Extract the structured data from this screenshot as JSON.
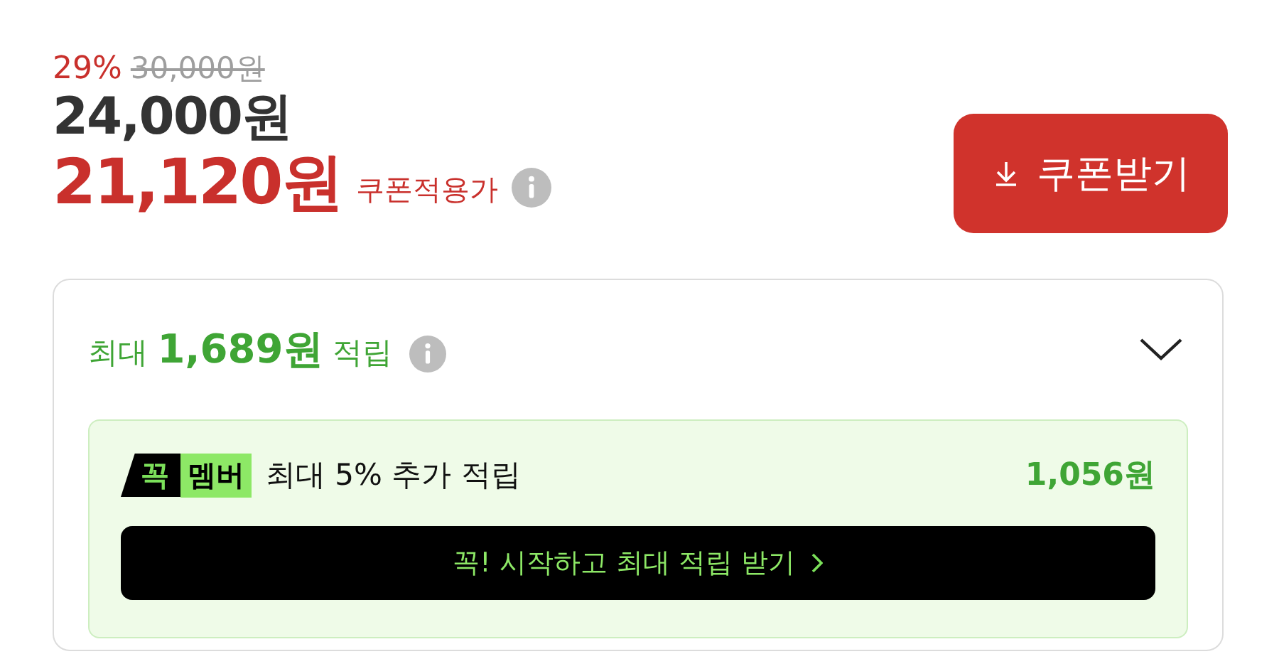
{
  "price": {
    "discount_rate": "29%",
    "original_price": "30,000원",
    "sale_price": "24,000원",
    "coupon_price": "21,120원",
    "coupon_label": "쿠폰적용가"
  },
  "coupon_button": {
    "label": "쿠폰받기"
  },
  "reward": {
    "summary": "최대 **1,689원** 적립",
    "membership": {
      "badge_mark": "꼭",
      "badge_label": "멤버",
      "description": "최대 5% 추가 적립",
      "amount": "1,056원",
      "cta": "꼭! 시작하고 최대 적립 받기"
    }
  }
}
